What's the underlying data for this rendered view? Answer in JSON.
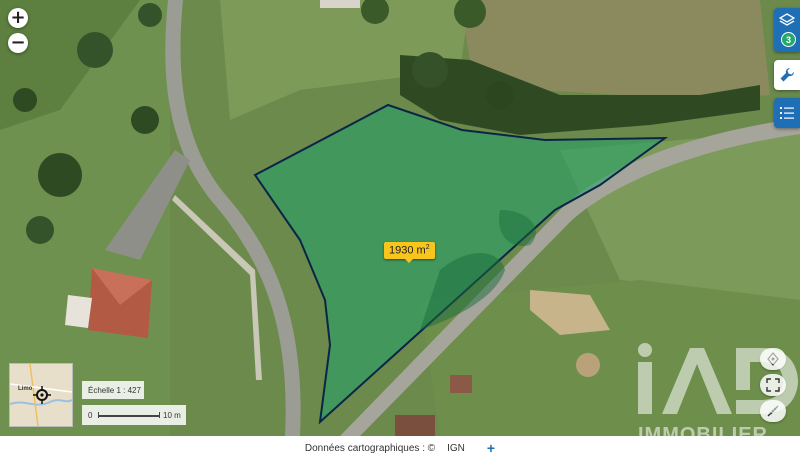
{
  "map": {
    "parcel": {
      "area_value": "1930 m",
      "area_exponent": "2",
      "fill_color": "#1fa36a",
      "stroke_color": "#0c2547"
    }
  },
  "controls": {
    "zoom_in": "+",
    "zoom_out": "−",
    "layers_count": "3",
    "icons": [
      "layers-icon",
      "wrench-icon",
      "legend-list-icon",
      "locate-icon",
      "fullscreen-icon",
      "measure-icon",
      "plus-icon"
    ]
  },
  "overview": {
    "place_label": "Limo"
  },
  "scale": {
    "label": "Échelle 1 : 427",
    "zero": "0",
    "max": "10 m"
  },
  "attribution": {
    "text": "Données cartographiques : ©",
    "provider": "IGN",
    "more": "+"
  },
  "watermark": {
    "logo": "iAD",
    "subtitle": "IMMOBILIER"
  },
  "colors": {
    "accent_blue": "#1f6fb6",
    "badge_green": "#27a86b",
    "label_yellow": "#f7c51b"
  }
}
